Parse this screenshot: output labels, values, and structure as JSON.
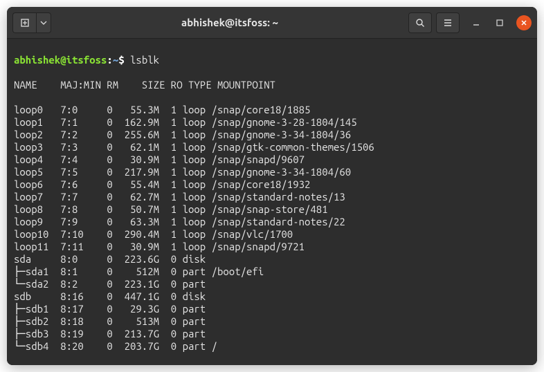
{
  "window": {
    "title": "abhishek@itsfoss: ~"
  },
  "prompt": {
    "user_host": "abhishek@itsfoss",
    "colon": ":",
    "path": "~",
    "dollar": "$"
  },
  "command": "lsblk",
  "columns": [
    "NAME",
    "MAJ:MIN",
    "RM",
    "SIZE",
    "RO",
    "TYPE",
    "MOUNTPOINT"
  ],
  "rows": [
    {
      "tree": "",
      "name": "loop0 ",
      "majmin": "7:0 ",
      "rm": "0",
      "size": "  55.3M",
      "ro": "1",
      "type": "loop",
      "mount": "/snap/core18/1885"
    },
    {
      "tree": "",
      "name": "loop1 ",
      "majmin": "7:1 ",
      "rm": "0",
      "size": " 162.9M",
      "ro": "1",
      "type": "loop",
      "mount": "/snap/gnome-3-28-1804/145"
    },
    {
      "tree": "",
      "name": "loop2 ",
      "majmin": "7:2 ",
      "rm": "0",
      "size": " 255.6M",
      "ro": "1",
      "type": "loop",
      "mount": "/snap/gnome-3-34-1804/36"
    },
    {
      "tree": "",
      "name": "loop3 ",
      "majmin": "7:3 ",
      "rm": "0",
      "size": "  62.1M",
      "ro": "1",
      "type": "loop",
      "mount": "/snap/gtk-common-themes/1506"
    },
    {
      "tree": "",
      "name": "loop4 ",
      "majmin": "7:4 ",
      "rm": "0",
      "size": "  30.9M",
      "ro": "1",
      "type": "loop",
      "mount": "/snap/snapd/9607"
    },
    {
      "tree": "",
      "name": "loop5 ",
      "majmin": "7:5 ",
      "rm": "0",
      "size": " 217.9M",
      "ro": "1",
      "type": "loop",
      "mount": "/snap/gnome-3-34-1804/60"
    },
    {
      "tree": "",
      "name": "loop6 ",
      "majmin": "7:6 ",
      "rm": "0",
      "size": "  55.4M",
      "ro": "1",
      "type": "loop",
      "mount": "/snap/core18/1932"
    },
    {
      "tree": "",
      "name": "loop7 ",
      "majmin": "7:7 ",
      "rm": "0",
      "size": "  62.7M",
      "ro": "1",
      "type": "loop",
      "mount": "/snap/standard-notes/13"
    },
    {
      "tree": "",
      "name": "loop8 ",
      "majmin": "7:8 ",
      "rm": "0",
      "size": "  50.7M",
      "ro": "1",
      "type": "loop",
      "mount": "/snap/snap-store/481"
    },
    {
      "tree": "",
      "name": "loop9 ",
      "majmin": "7:9 ",
      "rm": "0",
      "size": "  63.3M",
      "ro": "1",
      "type": "loop",
      "mount": "/snap/standard-notes/22"
    },
    {
      "tree": "",
      "name": "loop10",
      "majmin": "7:10",
      "rm": "0",
      "size": " 290.4M",
      "ro": "1",
      "type": "loop",
      "mount": "/snap/vlc/1700"
    },
    {
      "tree": "",
      "name": "loop11",
      "majmin": "7:11",
      "rm": "0",
      "size": "  30.9M",
      "ro": "1",
      "type": "loop",
      "mount": "/snap/snapd/9721"
    },
    {
      "tree": "",
      "name": "sda   ",
      "majmin": "8:0 ",
      "rm": "0",
      "size": " 223.6G",
      "ro": "0",
      "type": "disk",
      "mount": ""
    },
    {
      "tree": "├─",
      "name": "sda1  ",
      "majmin": "8:1 ",
      "rm": "0",
      "size": "   512M",
      "ro": "0",
      "type": "part",
      "mount": "/boot/efi"
    },
    {
      "tree": "└─",
      "name": "sda2  ",
      "majmin": "8:2 ",
      "rm": "0",
      "size": " 223.1G",
      "ro": "0",
      "type": "part",
      "mount": ""
    },
    {
      "tree": "",
      "name": "sdb   ",
      "majmin": "8:16",
      "rm": "0",
      "size": " 447.1G",
      "ro": "0",
      "type": "disk",
      "mount": ""
    },
    {
      "tree": "├─",
      "name": "sdb1  ",
      "majmin": "8:17",
      "rm": "0",
      "size": "  29.3G",
      "ro": "0",
      "type": "part",
      "mount": ""
    },
    {
      "tree": "├─",
      "name": "sdb2  ",
      "majmin": "8:18",
      "rm": "0",
      "size": "   513M",
      "ro": "0",
      "type": "part",
      "mount": ""
    },
    {
      "tree": "├─",
      "name": "sdb3  ",
      "majmin": "8:19",
      "rm": "0",
      "size": " 213.7G",
      "ro": "0",
      "type": "part",
      "mount": ""
    },
    {
      "tree": "└─",
      "name": "sdb4  ",
      "majmin": "8:20",
      "rm": "0",
      "size": " 203.7G",
      "ro": "0",
      "type": "part",
      "mount": "/"
    }
  ]
}
